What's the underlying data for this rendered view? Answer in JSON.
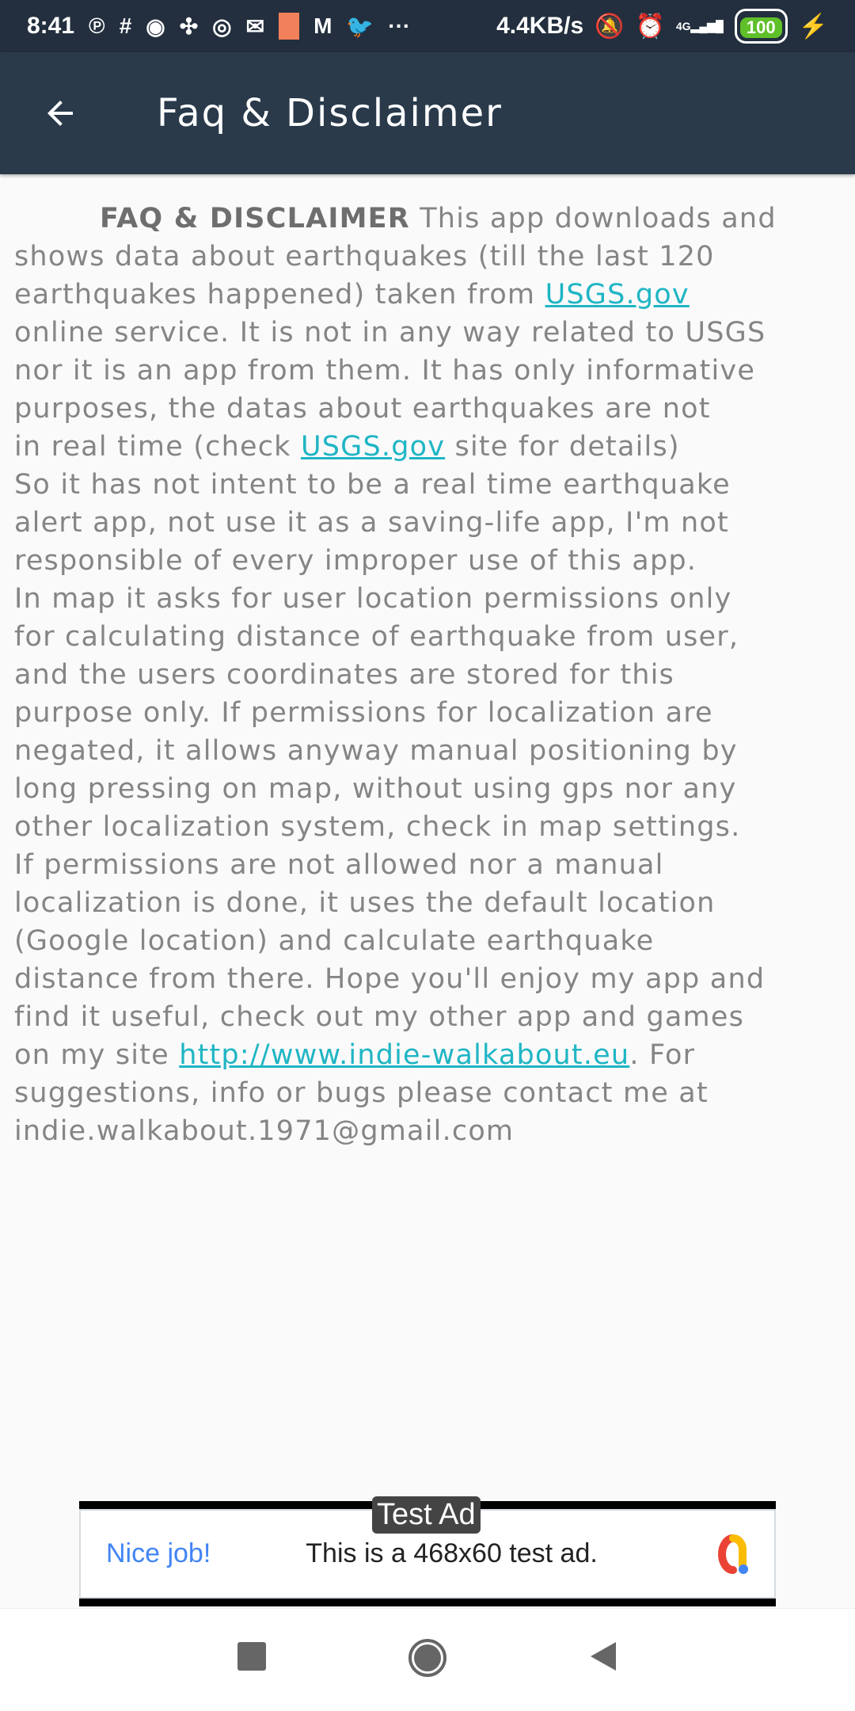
{
  "status": {
    "time": "8:41",
    "net_speed": "4.4KB/s",
    "signal": "4G",
    "battery": "100"
  },
  "toolbar": {
    "title": "Faq & Disclaimer"
  },
  "content": {
    "heading": "FAQ & DISCLAIMER",
    "l1": " This app downloads and",
    "l2": "shows data about earthquakes (till the last 120",
    "l3a": "earthquakes happened) taken from  ",
    "l3link": "USGS.gov",
    "l4": "online service. It is not in any way related to USGS",
    "l5": "nor it is an app from them. It has only informative",
    "l6": "purposes, the datas about earthquakes are not",
    "l7a": "in real time (check  ",
    "l7link": "USGS.gov",
    "l7b": " site  for details)",
    "l8": "So it has not intent to be a real time earthquake",
    "l9": "alert app, not use it as a saving-life app, I'm not",
    "l10": "responsible of every improper use of this app.",
    "l11": "In map it asks for user location permissions only",
    "l12": "for calculating distance of earthquake from user,",
    "l13": "and the users coordinates are stored for this",
    "l14": "purpose only. If permissions for localization are",
    "l15": "negated, it allows anyway manual positioning by",
    "l16": "long pressing on map, without using gps nor any",
    "l17": "other localization system, check in map settings.",
    "l18": "If permissions are not allowed nor a manual",
    "l19": "localization is done, it uses the default location",
    "l20": "(Google location) and calculate earthquake",
    "l21": "distance from there. Hope you'll enjoy my app and",
    "l22": "find it useful, check out my other app and games",
    "l23a": "on my site ",
    "l23link": "http://www.indie-walkabout.eu",
    "l23b": ". For",
    "l24": "suggestions, info or bugs please contact me at",
    "l25": "indie.walkabout.1971@gmail.com"
  },
  "ad": {
    "label": "Test Ad",
    "headline": "Nice job!",
    "text": "This is a 468x60 test ad."
  },
  "colors": {
    "toolbar": "#2a3a4b",
    "link": "#1fb5c4"
  }
}
